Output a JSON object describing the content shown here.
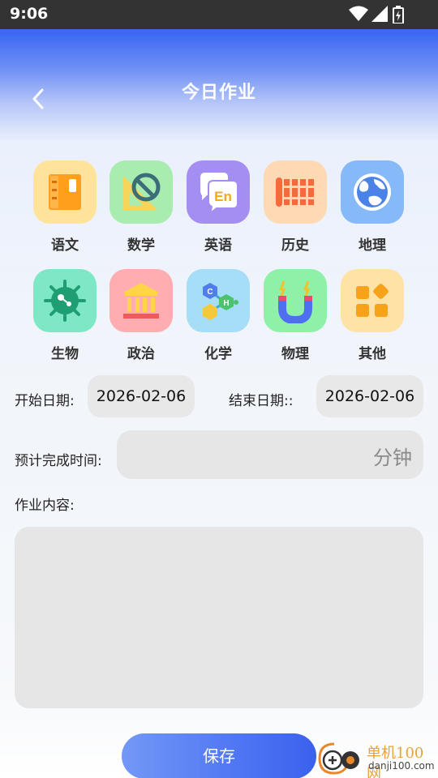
{
  "status_bar": {
    "time": "9:06"
  },
  "header": {
    "title": "今日作业"
  },
  "subjects": [
    {
      "label": "语文",
      "icon": "notebook-icon",
      "bg": "#ffe39a"
    },
    {
      "label": "数学",
      "icon": "protractor-icon",
      "bg": "#a8ecb0"
    },
    {
      "label": "英语",
      "icon": "english-chat-icon",
      "bg": "#a48ef2"
    },
    {
      "label": "历史",
      "icon": "bamboo-scroll-icon",
      "bg": "#ffd9b3"
    },
    {
      "label": "地理",
      "icon": "globe-icon",
      "bg": "#86b9f7"
    },
    {
      "label": "生物",
      "icon": "microbe-icon",
      "bg": "#7ee8c6"
    },
    {
      "label": "政治",
      "icon": "government-building-icon",
      "bg": "#ffadb0"
    },
    {
      "label": "化学",
      "icon": "molecule-icon",
      "bg": "#a6def7"
    },
    {
      "label": "物理",
      "icon": "magnet-icon",
      "bg": "#8ff0a8"
    },
    {
      "label": "其他",
      "icon": "grid-shapes-icon",
      "bg": "#ffe3a6"
    }
  ],
  "form": {
    "start_label": "开始日期:",
    "start_value": "2026-02-06",
    "end_label": "结束日期::",
    "end_value": "2026-02-06",
    "time_label": "预计完成时间:",
    "time_unit": "分钟",
    "content_label": "作业内容:"
  },
  "save_label": "保存",
  "watermark": {
    "title": "单机100网",
    "site": "danji100.com"
  }
}
